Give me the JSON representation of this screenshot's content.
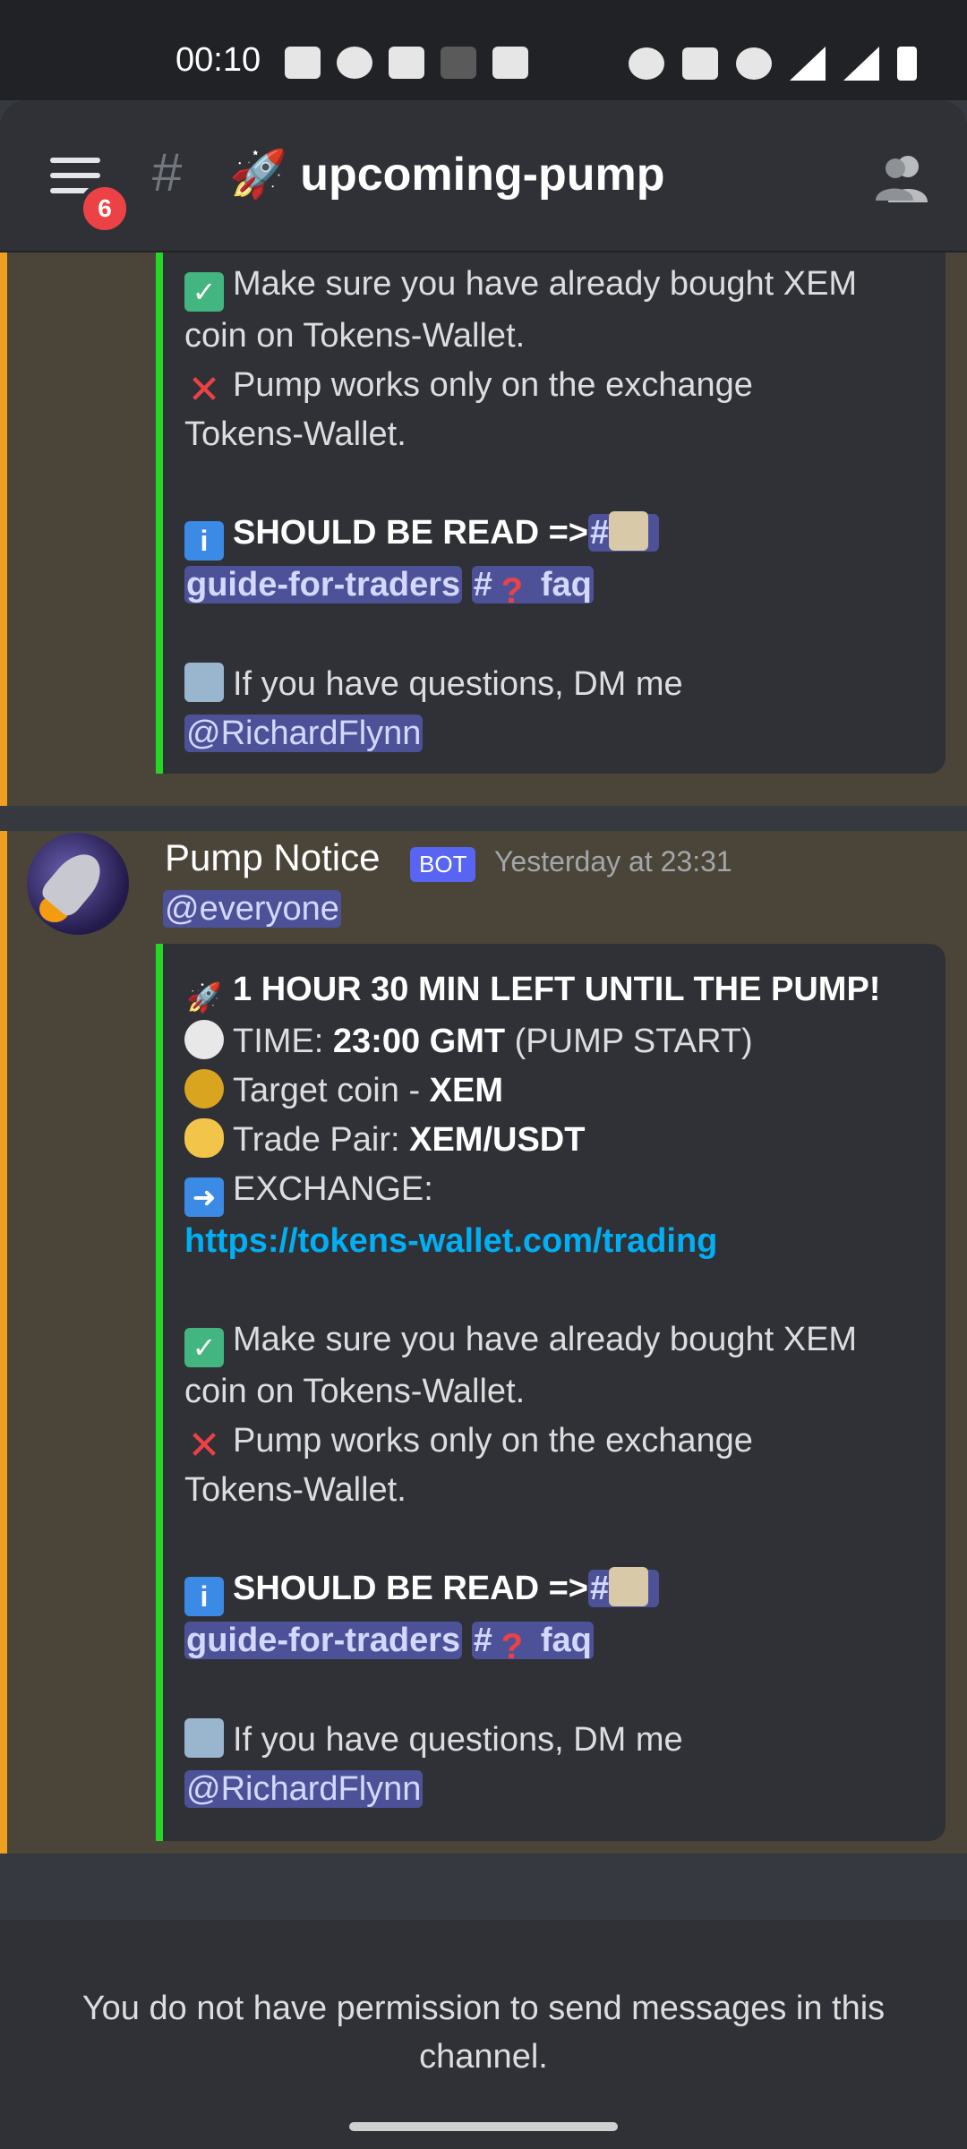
{
  "status_bar": {
    "time": "00:10"
  },
  "header": {
    "notification_count": "6",
    "hash_symbol": "#",
    "channel_emoji": "🚀",
    "channel_name": "upcoming-pump"
  },
  "message_1_embed": {
    "line_check_1": "Make sure you have already bought XEM",
    "line_check_2": "coin on Tokens-Wallet.",
    "line_cross_1": "Pump works only on the exchange",
    "line_cross_2": "Tokens-Wallet.",
    "read_label": "SHOULD BE READ =>",
    "chan_hash": "#",
    "guide_channel": "guide-for-traders",
    "faq_hash": "#",
    "faq_channel": "faq",
    "questions": "If you have questions, DM me",
    "mention": "@RichardFlynn"
  },
  "message_2": {
    "username": "Pump Notice",
    "bot_tag": "BOT",
    "timestamp": "Yesterday at 23:31",
    "mention_everyone": "@everyone",
    "embed": {
      "headline": "1 HOUR 30 MIN LEFT UNTIL THE PUMP!",
      "time_label": "TIME: ",
      "time_value": "23:00 GMT",
      "time_suffix": " (PUMP START)",
      "target_label": "Target coin - ",
      "target_value": "XEM",
      "pair_label": "Trade Pair: ",
      "pair_value": "XEM/USDT",
      "exchange_label": "EXCHANGE:",
      "exchange_link": "https://tokens-wallet.com/trading",
      "line_check_1": "Make sure you have already bought XEM",
      "line_check_2": "coin on Tokens-Wallet.",
      "line_cross_1": "Pump works only on the exchange",
      "line_cross_2": "Tokens-Wallet.",
      "read_label": "SHOULD BE READ =>",
      "chan_hash": "#",
      "guide_channel": "guide-for-traders",
      "faq_hash": "#",
      "faq_channel": "faq",
      "questions": "If you have questions, DM me",
      "mention": "@RichardFlynn"
    }
  },
  "footer": {
    "no_permission": "You do not have permission to send messages in this channel."
  },
  "colors": {
    "accent_orange": "#f0a020",
    "embed_green": "#26d526",
    "bot_blurple": "#5865f2",
    "badge_red": "#ed4245",
    "link_blue": "#00aff4"
  }
}
